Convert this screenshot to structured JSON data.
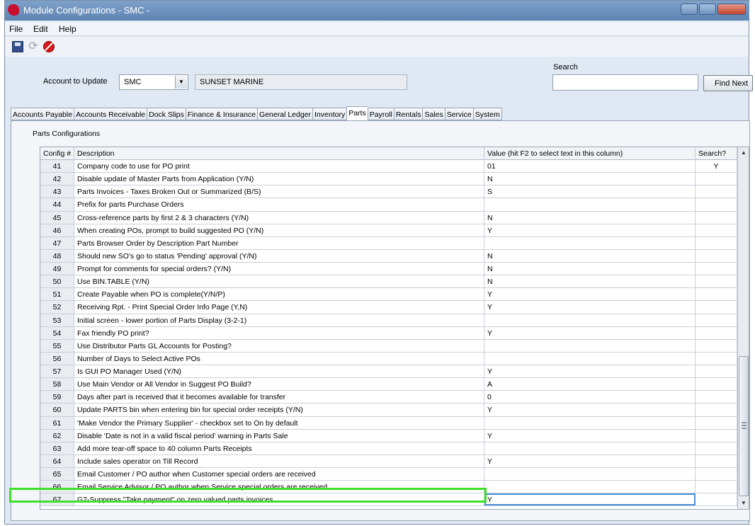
{
  "window": {
    "title": "Module Configurations - SMC -"
  },
  "menu": {
    "items": [
      "File",
      "Edit",
      "Help"
    ]
  },
  "toolbar": {
    "icons": [
      "save-icon",
      "refresh-icon",
      "stop-icon"
    ]
  },
  "account": {
    "label": "Account to Update",
    "code": "SMC",
    "name": "SUNSET MARINE"
  },
  "search": {
    "label": "Search",
    "value": "",
    "button": "Find Next"
  },
  "tabs": [
    "Accounts Payable",
    "Accounts Receivable",
    "Dock Slips",
    "Finance & Insurance",
    "General Ledger",
    "Inventory",
    "Parts",
    "Payroll",
    "Rentals",
    "Sales",
    "Service",
    "System"
  ],
  "active_tab": "Parts",
  "panel": {
    "title": "Parts Configurations"
  },
  "grid": {
    "columns": {
      "num": "Config #",
      "desc": "Description",
      "val": "Value (hit F2 to select text in this column)",
      "search": "Search?"
    },
    "rows": [
      {
        "num": "41",
        "desc": "Company code to use for PO print",
        "val": "01",
        "search": "Y"
      },
      {
        "num": "42",
        "desc": "Disable update of Master Parts from Application (Y/N)",
        "val": "N",
        "search": ""
      },
      {
        "num": "43",
        "desc": "Parts Invoices - Taxes Broken Out or Summarized (B/S)",
        "val": "S",
        "search": ""
      },
      {
        "num": "44",
        "desc": "Prefix for parts Purchase Orders",
        "val": "",
        "search": ""
      },
      {
        "num": "45",
        "desc": "Cross-reference parts by first 2 & 3 characters (Y/N)",
        "val": "N",
        "search": ""
      },
      {
        "num": "46",
        "desc": "When creating POs, prompt to build suggested PO (Y/N)",
        "val": "Y",
        "search": ""
      },
      {
        "num": "47",
        "desc": "Parts Browser Order by Description Part Number",
        "val": "",
        "search": ""
      },
      {
        "num": "48",
        "desc": "Should new SO's go to status 'Pending' approval (Y/N)",
        "val": "N",
        "search": ""
      },
      {
        "num": "49",
        "desc": "Prompt for comments for special orders? (Y/N)",
        "val": "N",
        "search": ""
      },
      {
        "num": "50",
        "desc": "Use BIN.TABLE (Y/N)",
        "val": "N",
        "search": ""
      },
      {
        "num": "51",
        "desc": "Create Payable when PO is complete(Y/N/P)",
        "val": "Y",
        "search": ""
      },
      {
        "num": "52",
        "desc": "Receiving Rpt. - Print Special Order Info Page (Y,N)",
        "val": "Y",
        "search": ""
      },
      {
        "num": "53",
        "desc": "Initial screen - lower portion of Parts Display (3-2-1)",
        "val": "",
        "search": ""
      },
      {
        "num": "54",
        "desc": "Fax friendly PO print?",
        "val": "Y",
        "search": ""
      },
      {
        "num": "55",
        "desc": "Use Distributor Parts GL Accounts for Posting?",
        "val": "",
        "search": ""
      },
      {
        "num": "56",
        "desc": "Number of Days to Select Active POs",
        "val": "",
        "search": ""
      },
      {
        "num": "57",
        "desc": "Is GUI PO Manager Used (Y/N)",
        "val": "Y",
        "search": ""
      },
      {
        "num": "58",
        "desc": "Use Main Vendor or All Vendor in Suggest PO Build?",
        "val": "A",
        "search": ""
      },
      {
        "num": "59",
        "desc": "Days after part is received that it becomes available for transfer",
        "val": "0",
        "search": ""
      },
      {
        "num": "60",
        "desc": "Update PARTS bin when entering bin for special order receipts (Y/N)",
        "val": "Y",
        "search": ""
      },
      {
        "num": "61",
        "desc": "'Make Vendor the Primary Supplier' - checkbox set to On by default",
        "val": "",
        "search": ""
      },
      {
        "num": "62",
        "desc": "Disable 'Date is not in a valid fiscal period' warning in Parts Sale",
        "val": "Y",
        "search": ""
      },
      {
        "num": "63",
        "desc": "Add more tear-off space to 40 column Parts Receipts",
        "val": "",
        "search": ""
      },
      {
        "num": "64",
        "desc": "Include sales operator on Till Record",
        "val": "Y",
        "search": ""
      },
      {
        "num": "65",
        "desc": "Email Customer / PO author when Customer special orders are received",
        "val": "",
        "search": ""
      },
      {
        "num": "66",
        "desc": "Email Service Advisor / PO author when Service special orders are received",
        "val": "",
        "search": ""
      },
      {
        "num": "67",
        "desc": "G2-Suppress \"Take payment\" on zero valued parts invoices",
        "val": "Y",
        "search": ""
      }
    ]
  },
  "colors": {
    "highlight": "#3ee02c",
    "selection": "#4a8fd8",
    "titlebar": "#6f94c1"
  }
}
